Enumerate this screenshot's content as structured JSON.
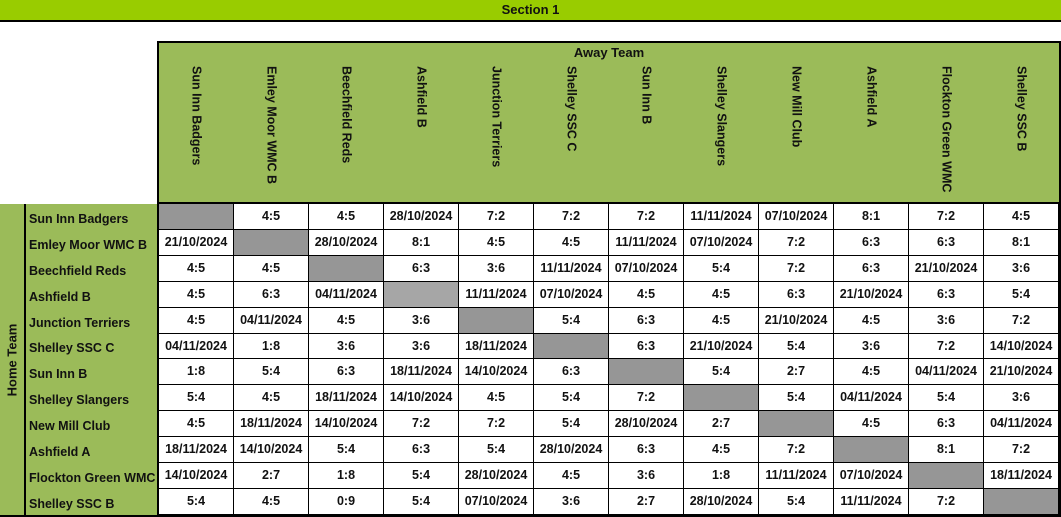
{
  "section_title": "Section 1",
  "away_label": "Away Team",
  "home_label": "Home Team",
  "colors": {
    "section_bar": "#99cc00",
    "header_green": "#9bbb59",
    "blank_cell": "#969696",
    "blank_cell_alt": "#a6a6a6"
  },
  "away_teams": [
    "Sun Inn Badgers",
    "Emley Moor WMC B",
    "Beechfield Reds",
    "Ashfield B",
    "Junction Terriers",
    "Shelley SSC C",
    "Sun Inn B",
    "Shelley Slangers",
    "New Mill Club",
    "Ashfield A",
    "Flockton Green WMC",
    "Shelley SSC B"
  ],
  "home_teams": [
    "Sun Inn Badgers",
    "Emley Moor WMC B",
    "Beechfield Reds",
    "Ashfield B",
    "Junction Terriers",
    "Shelley SSC C",
    "Sun Inn B",
    "Shelley Slangers",
    "New Mill Club",
    "Ashfield A",
    "Flockton Green WMC",
    "Shelley SSC B"
  ],
  "results": [
    [
      "",
      "4:5",
      "4:5",
      "28/10/2024",
      "7:2",
      "7:2",
      "7:2",
      "11/11/2024",
      "07/10/2024",
      "8:1",
      "7:2",
      "4:5"
    ],
    [
      "21/10/2024",
      "",
      "28/10/2024",
      "8:1",
      "4:5",
      "4:5",
      "11/11/2024",
      "07/10/2024",
      "7:2",
      "6:3",
      "6:3",
      "8:1"
    ],
    [
      "4:5",
      "4:5",
      "",
      "6:3",
      "3:6",
      "11/11/2024",
      "07/10/2024",
      "5:4",
      "7:2",
      "6:3",
      "21/10/2024",
      "3:6"
    ],
    [
      "4:5",
      "6:3",
      "04/11/2024",
      "",
      "11/11/2024",
      "07/10/2024",
      "4:5",
      "4:5",
      "6:3",
      "21/10/2024",
      "6:3",
      "5:4"
    ],
    [
      "4:5",
      "04/11/2024",
      "4:5",
      "3:6",
      "",
      "5:4",
      "6:3",
      "4:5",
      "21/10/2024",
      "4:5",
      "3:6",
      "7:2"
    ],
    [
      "04/11/2024",
      "1:8",
      "3:6",
      "3:6",
      "18/11/2024",
      "",
      "6:3",
      "21/10/2024",
      "5:4",
      "3:6",
      "7:2",
      "14/10/2024"
    ],
    [
      "1:8",
      "5:4",
      "6:3",
      "18/11/2024",
      "14/10/2024",
      "6:3",
      "",
      "5:4",
      "2:7",
      "4:5",
      "04/11/2024",
      "21/10/2024"
    ],
    [
      "5:4",
      "4:5",
      "18/11/2024",
      "14/10/2024",
      "4:5",
      "5:4",
      "7:2",
      "",
      "5:4",
      "04/11/2024",
      "5:4",
      "3:6"
    ],
    [
      "4:5",
      "18/11/2024",
      "14/10/2024",
      "7:2",
      "7:2",
      "5:4",
      "28/10/2024",
      "2:7",
      "",
      "4:5",
      "6:3",
      "04/11/2024"
    ],
    [
      "18/11/2024",
      "14/10/2024",
      "5:4",
      "6:3",
      "5:4",
      "28/10/2024",
      "6:3",
      "4:5",
      "7:2",
      "",
      "8:1",
      "7:2"
    ],
    [
      "14/10/2024",
      "2:7",
      "1:8",
      "5:4",
      "28/10/2024",
      "4:5",
      "3:6",
      "1:8",
      "11/11/2024",
      "07/10/2024",
      "",
      "18/11/2024"
    ],
    [
      "5:4",
      "4:5",
      "0:9",
      "5:4",
      "07/10/2024",
      "3:6",
      "2:7",
      "28/10/2024",
      "5:4",
      "11/11/2024",
      "7:2",
      ""
    ]
  ]
}
